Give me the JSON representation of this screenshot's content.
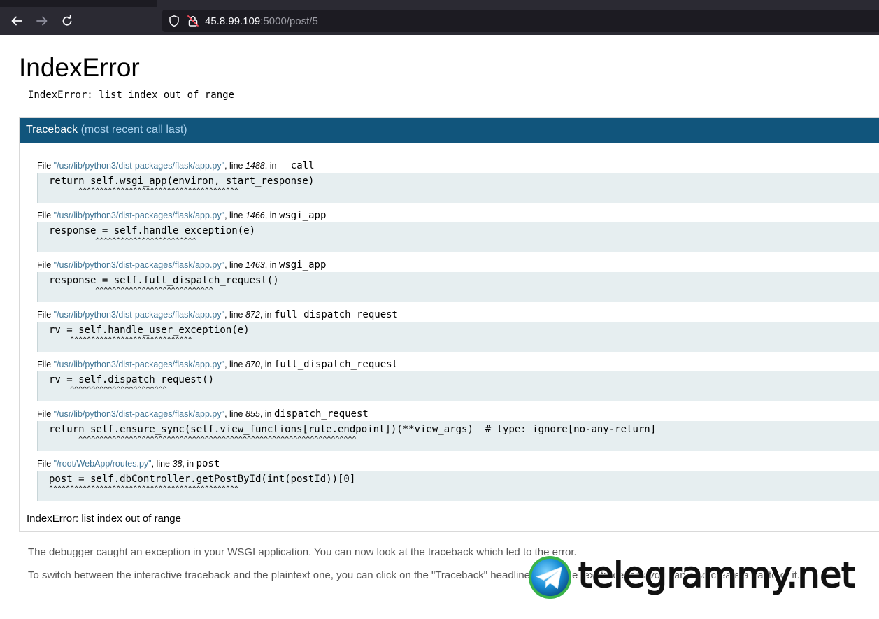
{
  "browser": {
    "url_host": "45.8.99.109",
    "url_rest": ":5000/post/5",
    "icons": {
      "back": "arrow-left-icon",
      "forward": "arrow-right-icon",
      "reload": "reload-icon",
      "shield": "shield-icon",
      "lock": "insecure-lock-icon"
    }
  },
  "error": {
    "title": "IndexError",
    "message": "IndexError: list index out of range"
  },
  "traceback": {
    "header_word": "Traceback",
    "header_sub": "(most recent call last)",
    "file_label": "File",
    "line_label": ", line",
    "in_label": ", in",
    "frames": [
      {
        "file": "\"/usr/lib/python3/dist-packages/flask/app.py\"",
        "line": "1488",
        "func": "__call__",
        "source": "return self.wsgi_app(environ, start_response)",
        "carets": "       ^^^^^^^^^^^^^^^^^^^^^^^^^^^^^^^^^^^^^^"
      },
      {
        "file": "\"/usr/lib/python3/dist-packages/flask/app.py\"",
        "line": "1466",
        "func": "wsgi_app",
        "source": "response = self.handle_exception(e)",
        "carets": "           ^^^^^^^^^^^^^^^^^^^^^^^^"
      },
      {
        "file": "\"/usr/lib/python3/dist-packages/flask/app.py\"",
        "line": "1463",
        "func": "wsgi_app",
        "source": "response = self.full_dispatch_request()",
        "carets": "           ^^^^^^^^^^^^^^^^^^^^^^^^^^^^"
      },
      {
        "file": "\"/usr/lib/python3/dist-packages/flask/app.py\"",
        "line": "872",
        "func": "full_dispatch_request",
        "source": "rv = self.handle_user_exception(e)",
        "carets": "     ^^^^^^^^^^^^^^^^^^^^^^^^^^^^^"
      },
      {
        "file": "\"/usr/lib/python3/dist-packages/flask/app.py\"",
        "line": "870",
        "func": "full_dispatch_request",
        "source": "rv = self.dispatch_request()",
        "carets": "     ^^^^^^^^^^^^^^^^^^^^^^^"
      },
      {
        "file": "\"/usr/lib/python3/dist-packages/flask/app.py\"",
        "line": "855",
        "func": "dispatch_request",
        "source": "return self.ensure_sync(self.view_functions[rule.endpoint])(**view_args)  # type: ignore[no-any-return]",
        "carets": "       ^^^^^^^^^^^^^^^^^^^^^^^^^^^^^^^^^^^^^^^^^^^^^^^^^^^^^^^^^^^^^^^^^^"
      },
      {
        "file": "\"/root/WebApp/routes.py\"",
        "line": "38",
        "func": "post",
        "source": "post = self.dbController.getPostById(int(postId))[0]",
        "carets": "^^^^^^^^^^^^^^^^^^^^^^^^^^^^^^^^^^^^^^^^^^^^^"
      }
    ],
    "footer_error": "IndexError: list index out of range"
  },
  "explanation": {
    "p1": "The debugger caught an exception in your WSGI application. You can now look at the traceback which led to the error.",
    "p2": "To switch between the interactive traceback and the plaintext one, you can click on the \"Traceback\" headline. From the text traceback you can also create a paste of it."
  },
  "watermark": {
    "text": "telegrammy.net",
    "icon": "telegram-logo-icon"
  }
}
